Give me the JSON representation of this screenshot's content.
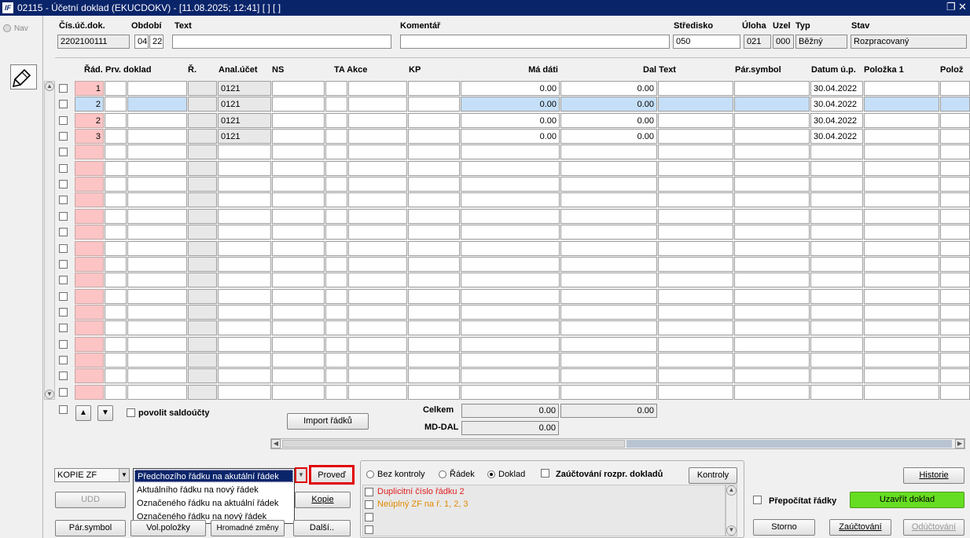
{
  "window": {
    "title": "02115 - Účetní doklad (EKUCDOKV) - [11.08.2025; 12:41]  [ ]  [ ]",
    "logo": "IF"
  },
  "nav": {
    "label": "Nav"
  },
  "header": {
    "labels": {
      "doc_no": "Čís.úč.dok.",
      "period": "Období",
      "text": "Text",
      "comment": "Komentář",
      "center": "Středisko",
      "task": "Úloha",
      "node": "Uzel",
      "type": "Typ",
      "status": "Stav"
    },
    "values": {
      "doc_no": "2202100111",
      "period_month": "04",
      "period_year": "22",
      "text": "",
      "comment": "",
      "center": "050",
      "task": "021",
      "node": "000",
      "type": "Běžný",
      "status": "Rozpracovaný"
    }
  },
  "grid": {
    "columns": {
      "row": "Řád.",
      "first_doc": "Prv. doklad",
      "r": "Ř.",
      "anal": "Anal.účet",
      "ns": "NS",
      "ta": "TA Akce",
      "kp": "KP",
      "md": "Má dáti",
      "dal": "Dal Text",
      "par": "Pár.symbol",
      "date": "Datum ú.p.",
      "item1": "Položka 1",
      "item2": "Polož"
    },
    "rows": [
      {
        "row": "1",
        "anal": "0121",
        "md": "0.00",
        "dal": "0.00",
        "date": "30.04.2022"
      },
      {
        "row": "2",
        "anal": "0121",
        "md": "0.00",
        "dal": "0.00",
        "date": "30.04.2022"
      },
      {
        "row": "2",
        "anal": "0121",
        "md": "0.00",
        "dal": "0.00",
        "date": "30.04.2022"
      },
      {
        "row": "3",
        "anal": "0121",
        "md": "0.00",
        "dal": "0.00",
        "date": "30.04.2022"
      }
    ]
  },
  "totals": {
    "label_total": "Celkem",
    "label_diff": "MD-DAL",
    "md_total": "0.00",
    "dal_total": "0.00",
    "diff": "0.00"
  },
  "below_grid": {
    "saldo_label": "povolit saldoúčty",
    "import_button": "Import řádků"
  },
  "copy": {
    "select_value": "KOPIE ZF",
    "options": [
      "Předchozího řádku na akutální řádek",
      "Aktuálního řádku na nový řádek",
      "Označeného řádku na aktuální řádek",
      "Označeného řádku na nový řádek"
    ],
    "run_button": "Proveď"
  },
  "buttons": {
    "udd": "UDD",
    "kopie": "Kopie",
    "par_symbol": "Pár.symbol",
    "vol_polozky": "Vol.položky",
    "hromadne": "Hromadné změny",
    "dalsi": "Další..",
    "historie": "Historie",
    "uzavrit": "Uzavřít doklad",
    "storno": "Storno",
    "zauctovani": "Zaúčtování",
    "oductovani": "Odúčtování",
    "kontroly": "Kontroly"
  },
  "control": {
    "radio_none": "Bez kontroly",
    "radio_row": "Řádek",
    "radio_doc": "Doklad",
    "check_rozpr": "Zaúčtování rozpr. dokladů",
    "selected": "Doklad"
  },
  "messages": [
    {
      "text": "Duplicitní číslo řádku 2",
      "color": "#e02020"
    },
    {
      "text": "Neúplný ZF na ř. 1, 2, 3",
      "color": "#e08a00"
    }
  ],
  "recalc_label": "Přepočítat řádky",
  "colors": {
    "title_bg": "#0a246a",
    "row_pink": "#fcc4c4",
    "highlight": "#c5dff8",
    "close_btn": "#66dd22",
    "selection": "#0a246a",
    "red_outline": "#e00000"
  }
}
